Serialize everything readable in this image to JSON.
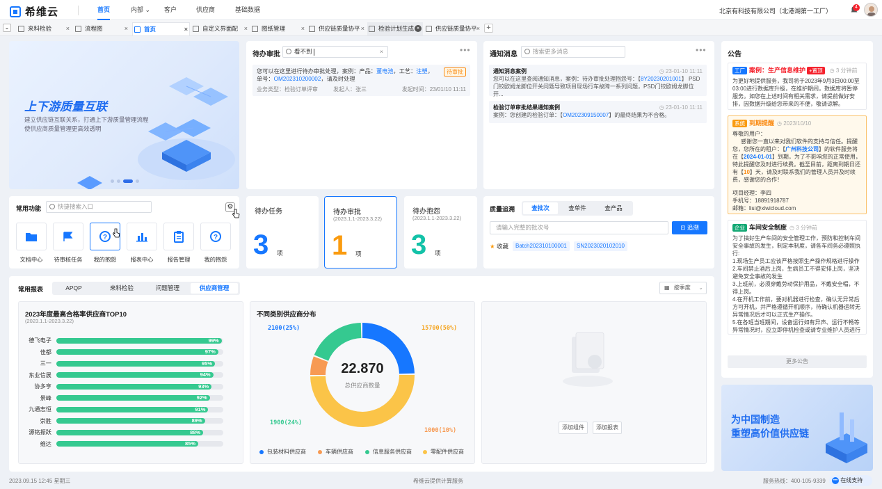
{
  "app": {
    "name": "希维云",
    "company": "北京有科技有限公司（北港湖第一工厂）",
    "notif_count": "4"
  },
  "nav": [
    {
      "label": "首页"
    },
    {
      "label": "内部"
    },
    {
      "label": "客户"
    },
    {
      "label": "供应商"
    },
    {
      "label": "基础数据"
    }
  ],
  "tabs": [
    {
      "label": "来料检验"
    },
    {
      "label": "流程图"
    },
    {
      "label": "首页"
    },
    {
      "label": "自定义界面配"
    },
    {
      "label": "图纸管理"
    },
    {
      "label": "供应链质量协平"
    },
    {
      "label": "检验计划生成"
    },
    {
      "label": "供应链质量协平"
    }
  ],
  "banner": {
    "title": "上下游质量互联",
    "sub1": "建立供应链互联关系，打通上下游质量管理流程",
    "sub2": "使供应商质量管理更高效透明"
  },
  "todo": {
    "title": "待办审批",
    "search_value": "看不到",
    "item": {
      "text1": "您可以在这里进行待办审批处理，案例：产品：",
      "product": "董电池",
      "text2": "，工艺：",
      "process": "注塑",
      "text3": "，",
      "text4": "单号：",
      "order": "OM2023102000​02",
      "text5": "，请及时处理",
      "tag": "待审批",
      "type": "业务类型：检验订单评审",
      "initiator": "发起人：张三",
      "time": "发起时间：23/01/10 11:11"
    }
  },
  "notice": {
    "title": "通知消息",
    "placeholder": "搜索更多消息",
    "items": [
      {
        "title": "通知消息案例",
        "time": "23-01-10 11:11",
        "body1": "您可以在这里查阅通知消息，案例：待办审批处理抱怨号：【",
        "link": "8Y20230201001",
        "body2": "】 PSD门铰欧姆龙脚位开关问题导致项目现场行车故障一系列问题，PSD门铰欧姆龙脚位开..."
      },
      {
        "title": "检验订单审批结果通知案例",
        "time": "23-01-10 11:11",
        "body1": "案例：您创建的检验订单：【",
        "link": "OM202309150007",
        "body2": "】的最终结果为不合格。"
      }
    ]
  },
  "announce": {
    "title": "公告",
    "more": "更多公告",
    "items": [
      {
        "chip": "工厂",
        "head": "案例：生产信息维护",
        "hot": "+置顶",
        "time": "3 分钟前",
        "body": "为更好地提供服务，我司将于2023年9月3日00:00至03:00进行数据库升级，在维护期间，数据库将暂停服务。如您在上述时间有相关需求，请提前做好安排，因数据升级给您带来的不便，敬请谅解。"
      },
      {
        "chip": "系统",
        "head": "到期提醒",
        "time": "2023/10/10",
        "l1": "尊敬的用户：",
        "l2": "感谢您一直以来对我们软件的支持与信任。提醒您，您所在的租户：【",
        "tenant": "广州科技公司",
        "l3": "】的软件服务将在【",
        "date": "2024-01-01",
        "l4": "】到期，为了不影响您的正常使用，特此提醒您及时进行续费。截至目前，距离到期日还有【",
        "days": "10",
        "l5": "】天，请及时联系我们的管理人员并及时续费，感谢您的合作！",
        "pm": "项目经理：李四",
        "phone": "手机号：18891918787",
        "mail": "邮箱：lisi@xiwicloud.com"
      },
      {
        "chip": "企业",
        "head": "车间安全制度",
        "time": "3 分钟前",
        "body": "为了搞好生产车间的安全管理工作，预防和控制车间安全事故的发生，制定本制度，请各车间务必遵照执行:\n1.现场生产员工应该严格按照生产操作规格进行操作\n2.车间禁止酒后上岗，生病员工不得安排上岗，坚决避免安全事故的发生\n3.上班前，必须穿戴劳动保护用品，不戴安全帽，不得上岗。\n4.在开机工作前，要对机器进行检查，确认无异常后方可开机，并严格遵循开机顺序，待确认机器运转无异常情况后才可以正式生产操作。\n5.在各班当班期间，设备运行如有异声、运行不畅等异常情况时，应立即停机检查或请专业维护人员进行修理，以防造成设备重大损坏事故或产品质量事故..."
      }
    ]
  },
  "functions": {
    "title": "常用功能",
    "placeholder": "快捷搜索入口",
    "items": [
      {
        "label": "文档中心"
      },
      {
        "label": "待审核任务"
      },
      {
        "label": "我的抱怨"
      },
      {
        "label": "报表中心"
      },
      {
        "label": "报告管理"
      },
      {
        "label": "我的抱怨"
      }
    ]
  },
  "counters": [
    {
      "title": "待办任务",
      "date": "",
      "value": "3",
      "unit": "项",
      "color": "#1677ff"
    },
    {
      "title": "待办审批",
      "date": "(2023.1.1-2023.3.22)",
      "value": "1",
      "unit": "项",
      "color": "#fa9b0f"
    },
    {
      "title": "待办抱怨",
      "date": "(2023.1.1-2023.3.22)",
      "value": "3",
      "unit": "项",
      "color": "#13c2a8"
    }
  ],
  "trace": {
    "title": "质量追溯",
    "tabs": [
      "查批次",
      "查单件",
      "查产品"
    ],
    "placeholder": "请输入完整的批次号",
    "button": "追溯",
    "fav": "收藏",
    "pills": [
      "Batch202310100001",
      "SN2023020102010"
    ]
  },
  "reports": {
    "title": "常用报表",
    "tabs": [
      "APQP",
      "来料检验",
      "问题管理",
      "供应商管理"
    ],
    "period": "按季度",
    "add_widget": "添加组件",
    "add_report": "添加报表"
  },
  "chart_data": [
    {
      "type": "bar",
      "title": "2023年度最高合格率供应商TOP10",
      "subtitle": "(2023.1.1-2023.3.22)",
      "categories": [
        "德飞电子",
        "佳都",
        "三一",
        "东业信展",
        "协多亨",
        "景峰",
        "九通志恒",
        "崇胜",
        "源铭振跃",
        "维达"
      ],
      "values": [
        99,
        97,
        95,
        94,
        93,
        92,
        91,
        89,
        88,
        85
      ],
      "unit": "%",
      "xlim": [
        0,
        100
      ]
    },
    {
      "type": "pie",
      "title": "不同类别供应商分布",
      "center_value": "22.870",
      "center_label": "总供应商数量",
      "slices": [
        {
          "name": "包装材料供应商",
          "value": 2100,
          "pct": "25%",
          "color": "#1677ff"
        },
        {
          "name": "零配件供应商",
          "value": 15700,
          "pct": "50%",
          "color": "#fbc448"
        },
        {
          "name": "车辆供应商",
          "value": 1000,
          "pct": "10%",
          "color": "#f79a53"
        },
        {
          "name": "信息服务供应商",
          "value": 1900,
          "pct": "24%",
          "color": "#35c990"
        }
      ],
      "labels": [
        "2100(25%)",
        "15700(50%)",
        "1900(24%)",
        "1000(10%)"
      ]
    }
  ],
  "footer": {
    "datetime": "2023.09.15 12:45 星期三",
    "center": "希维云提供计算服务",
    "hotline": "服务热线：400-105-9339",
    "support": "在线支持"
  }
}
